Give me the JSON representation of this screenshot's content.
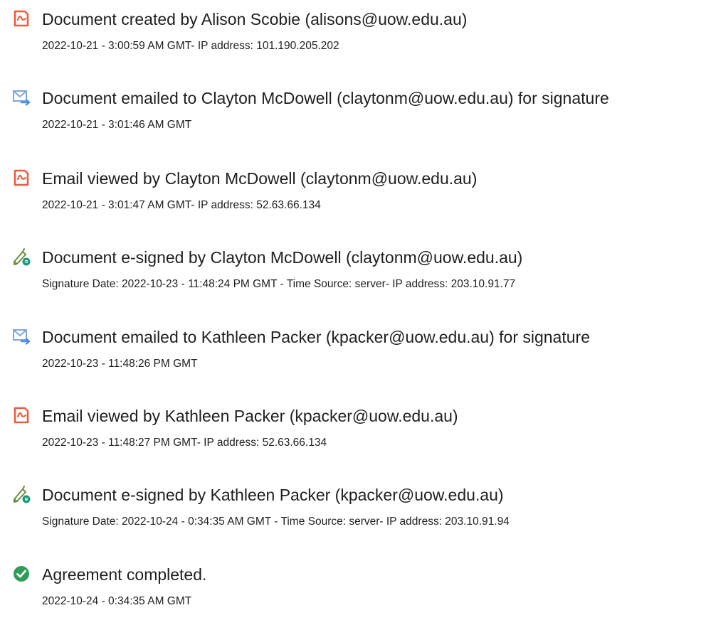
{
  "events": [
    {
      "icon": "document-created-icon",
      "title": "Document created by Alison Scobie (alisons@uow.edu.au)",
      "detail": "2022-10-21 - 3:00:59 AM GMT- IP address: 101.190.205.202"
    },
    {
      "icon": "email-sent-icon",
      "title": "Document emailed to Clayton McDowell (claytonm@uow.edu.au) for signature",
      "detail": "2022-10-21 - 3:01:46 AM GMT"
    },
    {
      "icon": "email-viewed-icon",
      "title": "Email viewed by Clayton McDowell (claytonm@uow.edu.au)",
      "detail": "2022-10-21 - 3:01:47 AM GMT- IP address: 52.63.66.134"
    },
    {
      "icon": "e-sign-pen-icon",
      "title": "Document e-signed by Clayton McDowell (claytonm@uow.edu.au)",
      "detail": "Signature Date: 2022-10-23 - 11:48:24 PM GMT - Time Source: server- IP address: 203.10.91.77"
    },
    {
      "icon": "email-sent-icon",
      "title": "Document emailed to Kathleen Packer (kpacker@uow.edu.au) for signature",
      "detail": "2022-10-23 - 11:48:26 PM GMT"
    },
    {
      "icon": "email-viewed-icon",
      "title": "Email viewed by Kathleen Packer (kpacker@uow.edu.au)",
      "detail": "2022-10-23 - 11:48:27 PM GMT- IP address: 52.63.66.134"
    },
    {
      "icon": "e-sign-pen-icon",
      "title": "Document e-signed by Kathleen Packer (kpacker@uow.edu.au)",
      "detail": "Signature Date: 2022-10-24 - 0:34:35 AM GMT - Time Source: server- IP address: 203.10.91.94"
    },
    {
      "icon": "checkmark-circle-icon",
      "title": "Agreement completed.",
      "detail": "2022-10-24 - 0:34:35 AM GMT"
    }
  ],
  "colors": {
    "acrobat_red": "#ee5b3d",
    "email_blue": "#7fa6d9",
    "arrow_blue": "#4a8fe0",
    "pen_green": "#6a8d3b",
    "badge_teal": "#1e9a7f",
    "check_green": "#2e9d58",
    "text": "#1f1f1f"
  }
}
